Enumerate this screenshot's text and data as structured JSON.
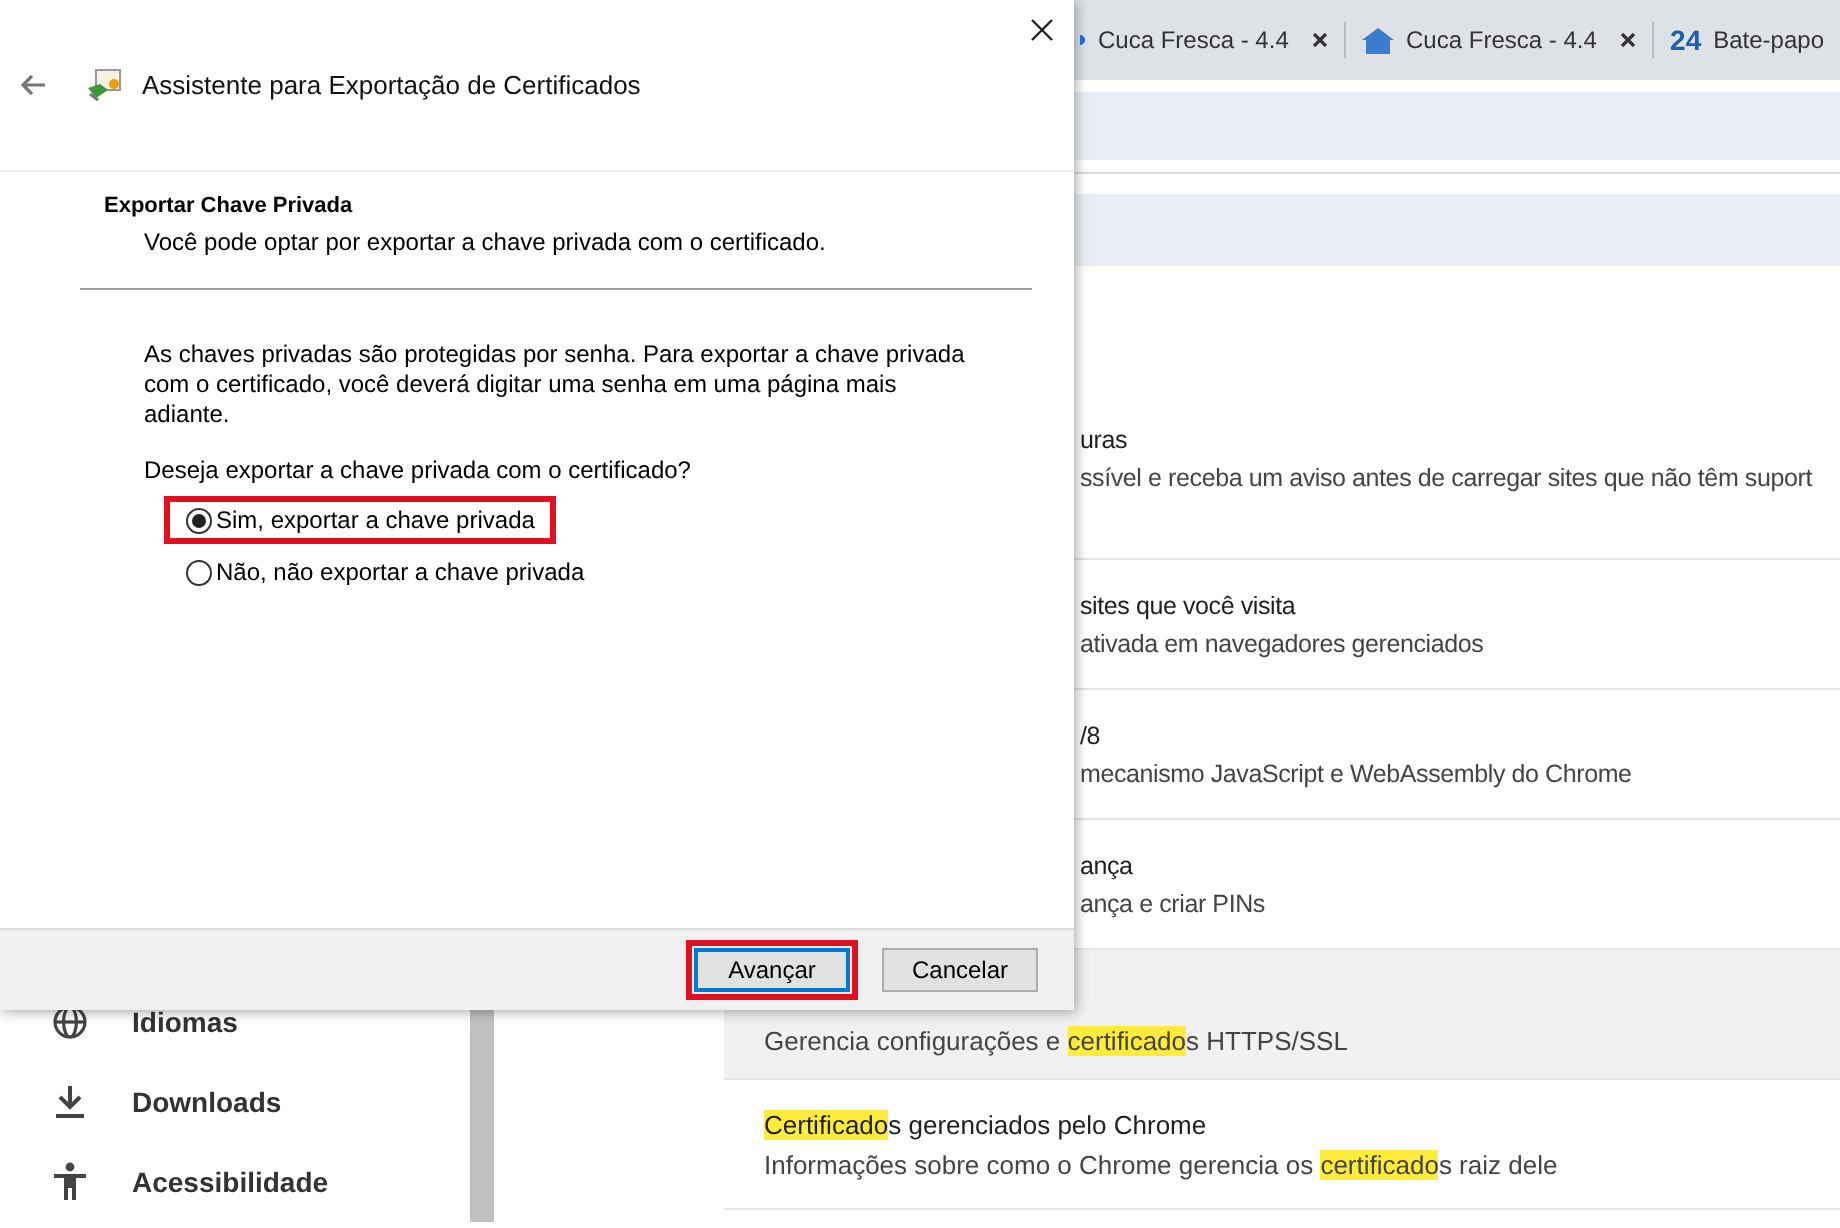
{
  "browser": {
    "tabs": [
      {
        "kind": "page",
        "title": "Cuca Fresca - 4.4"
      },
      {
        "kind": "page",
        "title": "Cuca Fresca - 4.4"
      },
      {
        "kind": "chat",
        "badge": "24",
        "title": "Bate-papo"
      }
    ]
  },
  "settings_rows": [
    {
      "kind": "partial",
      "hovered": false,
      "title": [
        {
          "text": "uras",
          "highlight": false
        }
      ],
      "description": [
        {
          "text": "ssível e receba um aviso antes de carregar sites que não têm suport",
          "highlight": false
        }
      ]
    },
    {
      "kind": "partial",
      "hovered": false,
      "title": [
        {
          "text": "sites que você visita",
          "highlight": false
        }
      ],
      "description": [
        {
          "text": "ativada em navegadores gerenciados",
          "highlight": false
        }
      ]
    },
    {
      "kind": "partial",
      "hovered": false,
      "title": [
        {
          "text": "/8",
          "highlight": false
        }
      ],
      "description": [
        {
          "text": "mecanismo JavaScript e WebAssembly do Chrome",
          "highlight": false
        }
      ]
    },
    {
      "kind": "partial",
      "hovered": false,
      "title": [
        {
          "text": "ança",
          "highlight": false
        }
      ],
      "description": [
        {
          "text": "ança e criar PINs",
          "highlight": false
        }
      ]
    },
    {
      "kind": "full",
      "hovered": true,
      "description": [
        {
          "text": "Gerencia configurações e ",
          "highlight": false
        },
        {
          "text": "certificado",
          "highlight": true
        },
        {
          "text": "s HTTPS/SSL",
          "highlight": false
        }
      ]
    },
    {
      "kind": "full",
      "hovered": false,
      "title": [
        {
          "text": "Certificado",
          "highlight": true
        },
        {
          "text": "s gerenciados pelo Chrome",
          "highlight": false
        }
      ],
      "description": [
        {
          "text": "Informações sobre como o Chrome gerencia os ",
          "highlight": false
        },
        {
          "text": "certificado",
          "highlight": true
        },
        {
          "text": "s raiz dele",
          "highlight": false
        }
      ]
    }
  ],
  "sidebar": {
    "items": [
      {
        "kind": "globe",
        "label": "Idiomas"
      },
      {
        "kind": "download",
        "label": "Downloads"
      },
      {
        "kind": "accessibility",
        "label": "Acessibilidade"
      }
    ]
  },
  "dialog": {
    "title": "Assistente para Exportação de Certificados",
    "heading": "Exportar Chave Privada",
    "subheading": "Você pode optar por exportar a chave privada com o certificado.",
    "body": "As chaves privadas são protegidas por senha. Para exportar a chave privada com o certificado, você deverá digitar uma senha em uma página mais adiante.",
    "question": "Deseja exportar a chave privada com o certificado?",
    "options": [
      {
        "label": "Sim, exportar a chave privada",
        "selected": true,
        "marked": true
      },
      {
        "label": "Não, não exportar a chave privada",
        "selected": false,
        "marked": false
      }
    ],
    "buttons": [
      {
        "label": "Avançar",
        "default": true,
        "marked": true
      },
      {
        "label": "Cancelar",
        "default": false,
        "marked": false
      }
    ]
  }
}
